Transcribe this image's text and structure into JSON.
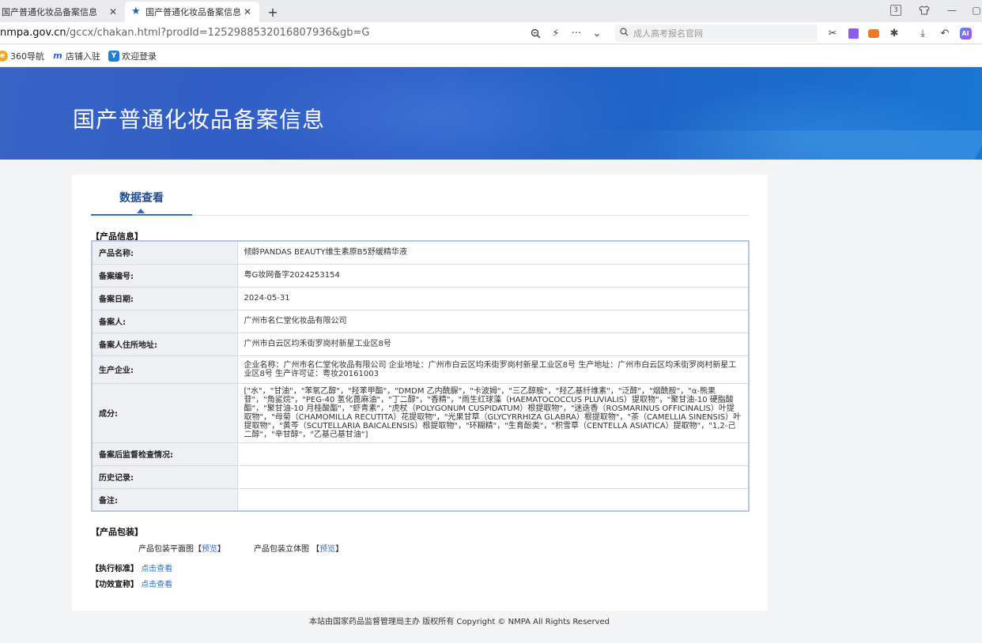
{
  "browser": {
    "tabs": [
      {
        "title": "国产普通化妆品备案信息",
        "active": false
      },
      {
        "title": "国产普通化妆品备案信息",
        "active": true
      }
    ],
    "new_tab": "+",
    "tab_count_badge": "3",
    "url_host": "nmpa.gov.cn",
    "url_path": "/gccx/chakan.html?prodId=1252988532016807936&gb=G",
    "search_placeholder": "成人高考报名官网",
    "bookmarks": [
      {
        "label": "360导航",
        "color": "#f0a91a"
      },
      {
        "label": "店铺入驻",
        "color": "#2a62c9"
      },
      {
        "label": "欢迎登录",
        "color": "#1f7fd6"
      }
    ],
    "ai_label": "AI"
  },
  "banner": {
    "title": "国产普通化妆品备案信息"
  },
  "tab": {
    "label": "数据查看"
  },
  "product_info": {
    "section_title": "【产品信息】",
    "rows": [
      {
        "key": "产品名称:",
        "value": "倾龄PANDAS BEAUTY维生素原B5舒缓精华液"
      },
      {
        "key": "备案编号:",
        "value": "粤G妆网备字2024253154"
      },
      {
        "key": "备案日期:",
        "value": "2024-05-31"
      },
      {
        "key": "备案人:",
        "value": "广州市名仁堂化妆品有限公司"
      },
      {
        "key": "备案人住所地址:",
        "value": "广州市白云区均禾街罗岗村新星工业区8号"
      },
      {
        "key": "生产企业:",
        "value": "企业名称：广州市名仁堂化妆品有限公司 企业地址：广州市白云区均禾街罗岗村新星工业区8号 生产地址：广州市白云区均禾街罗岗村新星工业区8号 生产许可证：粤妆20161003"
      },
      {
        "key": "成分:",
        "value": "[\"水\"，\"甘油\"，\"苯氧乙醇\"，\"羟苯甲酯\"，\"DMDM 乙内酰脲\"，\"卡波姆\"，\"三乙醇胺\"，\"羟乙基纤维素\"，\"泛醇\"，\"烟酰胺\"，\"α-熊果苷\"，\"角鲨烷\"，\"PEG-40 氢化蓖麻油\"，\"丁二醇\"，\"香精\"，\"雨生红球藻（HAEMATOCOCCUS PLUVIALIS）提取物\"，\"聚甘油-10 硬脂酸酯\"，\"聚甘油-10 月桂酸酯\"，\"虾青素\"，\"虎杖（POLYGONUM CUSPIDATUM）根提取物\"，\"迷迭香（ROSMARINUS OFFICINALIS）叶提取物\"，\"母菊（CHAMOMILLA RECUTITA）花提取物\"，\"光果甘草（GLYCYRRHIZA GLABRA）根提取物\"，\"茶（CAMELLIA SINENSIS）叶提取物\"，\"黄芩（SCUTELLARIA BAICALENSIS）根提取物\"，\"环糊精\"，\"生育酚类\"，\"积雪草（CENTELLA ASIATICA）提取物\"，\"1,2-己二醇\"，\"辛甘醇\"，\"乙基己基甘油\"]"
      },
      {
        "key": "备案后监督检查情况:",
        "value": ""
      },
      {
        "key": "历史记录:",
        "value": ""
      },
      {
        "key": "备注:",
        "value": ""
      }
    ]
  },
  "packaging": {
    "section_title": "【产品包装】",
    "flat_label": "产品包装平面图",
    "flat_link": "预览",
    "solid_label": "产品包装立体图",
    "solid_link": "预览"
  },
  "standard": {
    "label": "【执行标准】",
    "link": "点击查看"
  },
  "efficacy": {
    "label": "【功效宣称】",
    "link": "点击查看"
  },
  "footer": {
    "text": "本站由国家药品监督管理局主办 版权所有 Copyright © NMPA All Rights Reserved"
  }
}
